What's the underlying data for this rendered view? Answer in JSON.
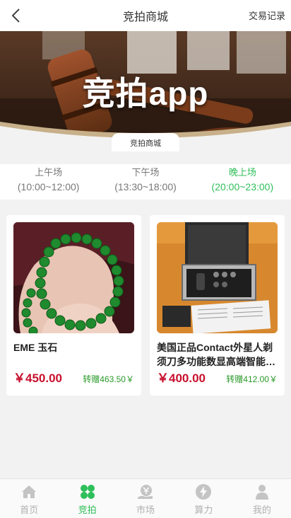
{
  "header": {
    "title": "竞拍商城",
    "records_label": "交易记录",
    "back_icon": "chevron-left-icon"
  },
  "banner": {
    "title": "竞拍app",
    "badge": "竞拍商城"
  },
  "sessions": [
    {
      "name": "上午场",
      "time": "(10:00~12:00)",
      "active": false
    },
    {
      "name": "下午场",
      "time": "(13:30~18:00)",
      "active": false
    },
    {
      "name": "晚上场",
      "time": "(20:00~23:00)",
      "active": true
    }
  ],
  "products": [
    {
      "name": "EME 玉石",
      "price": "￥450.00",
      "gift": "转赠463.50￥",
      "image": "jade-bracelet-image"
    },
    {
      "name": "美国正品Contact外星人剃须刀多功能数显高端智能…",
      "price": "￥400.00",
      "gift": "转赠412.00￥",
      "image": "shaver-kit-case-image"
    }
  ],
  "tabbar": [
    {
      "label": "首页",
      "icon": "home-icon",
      "active": false
    },
    {
      "label": "竞拍",
      "icon": "clover-icon",
      "active": true
    },
    {
      "label": "市场",
      "icon": "market-yen-icon",
      "active": false
    },
    {
      "label": "算力",
      "icon": "lightning-icon",
      "active": false
    },
    {
      "label": "我的",
      "icon": "user-icon",
      "active": false
    }
  ],
  "colors": {
    "accent": "#2fbf5a",
    "price": "#c8102e",
    "gift": "#2a9a2a",
    "inactive": "#b0b0b0"
  }
}
